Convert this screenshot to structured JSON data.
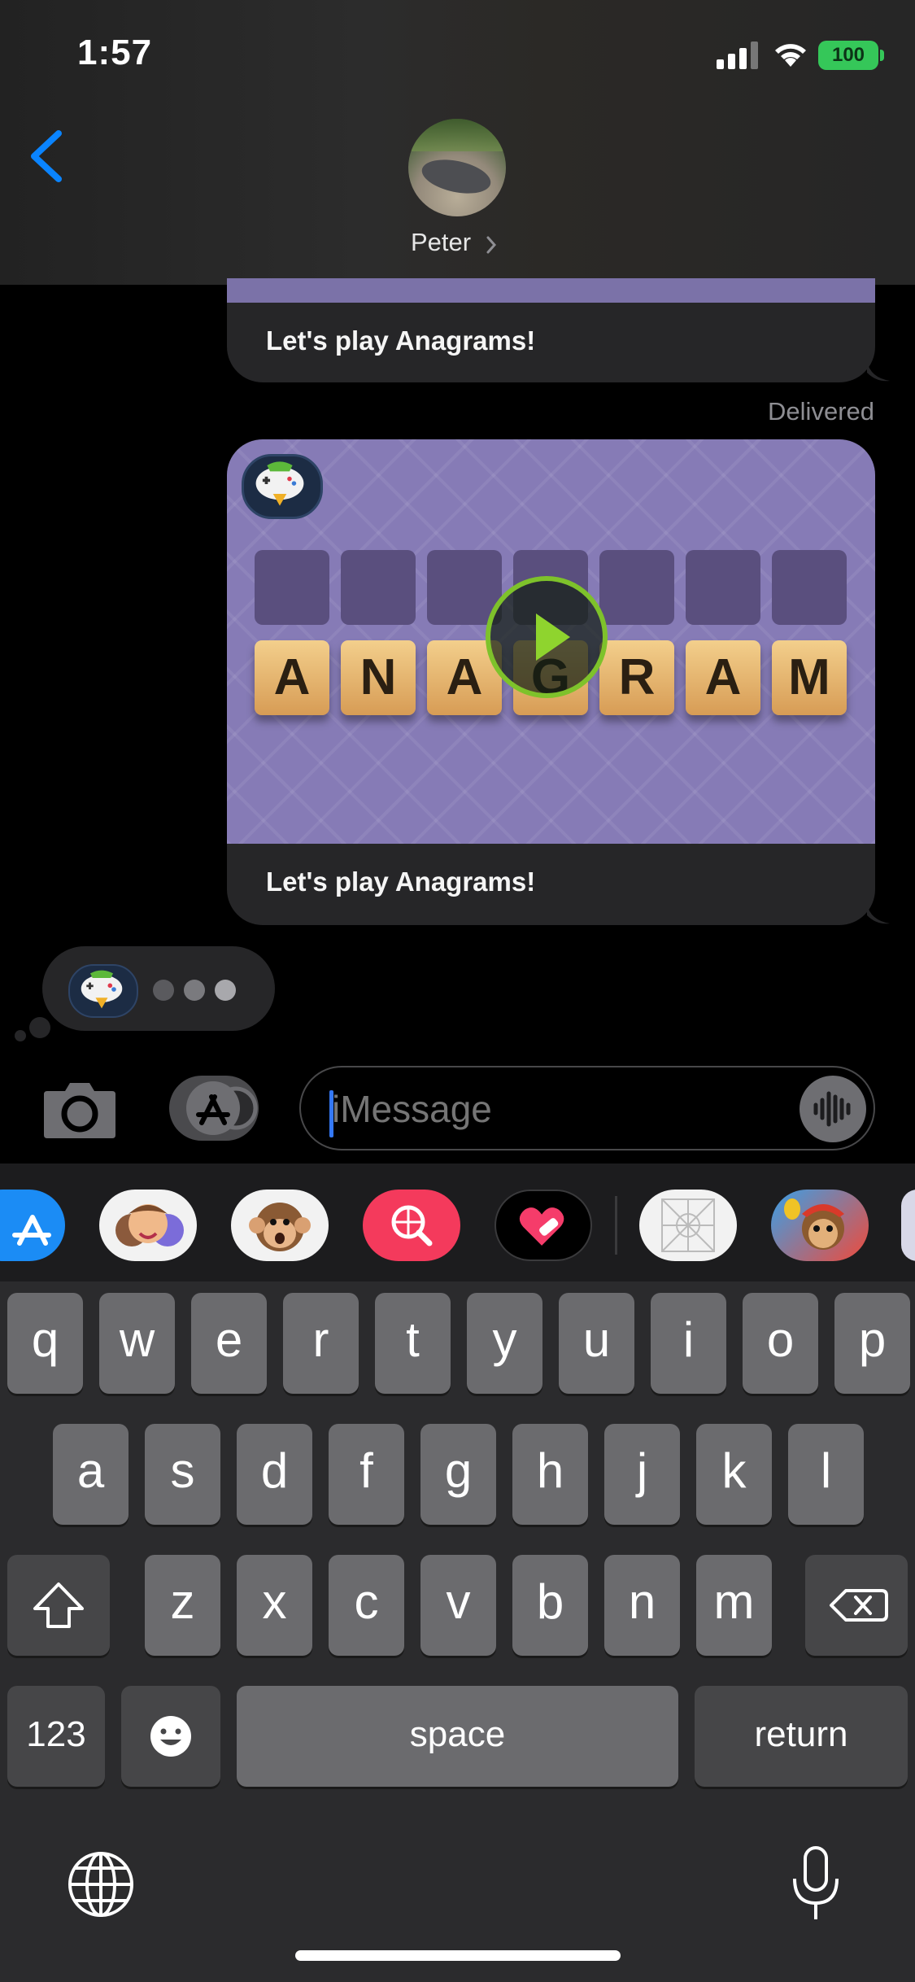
{
  "status_bar": {
    "time": "1:57",
    "battery": "100"
  },
  "header": {
    "contact_name": "Peter"
  },
  "messages": {
    "previous_caption": "Let's play Anagrams!",
    "delivered_label": "Delivered",
    "game_caption": "Let's play Anagrams!",
    "game_tiles": [
      "A",
      "N",
      "A",
      "G",
      "R",
      "A",
      "M"
    ]
  },
  "compose": {
    "placeholder": "iMessage"
  },
  "keyboard": {
    "row1": [
      "q",
      "w",
      "e",
      "r",
      "t",
      "y",
      "u",
      "i",
      "o",
      "p"
    ],
    "row2": [
      "a",
      "s",
      "d",
      "f",
      "g",
      "h",
      "j",
      "k",
      "l"
    ],
    "row3": [
      "z",
      "x",
      "c",
      "v",
      "b",
      "n",
      "m"
    ],
    "numbers_key": "123",
    "space_key": "space",
    "return_key": "return"
  },
  "colors": {
    "accent": "#0a84ff",
    "bubble": "#262628",
    "game_bg": "#867bb6",
    "play_ring": "#7ec22b"
  }
}
